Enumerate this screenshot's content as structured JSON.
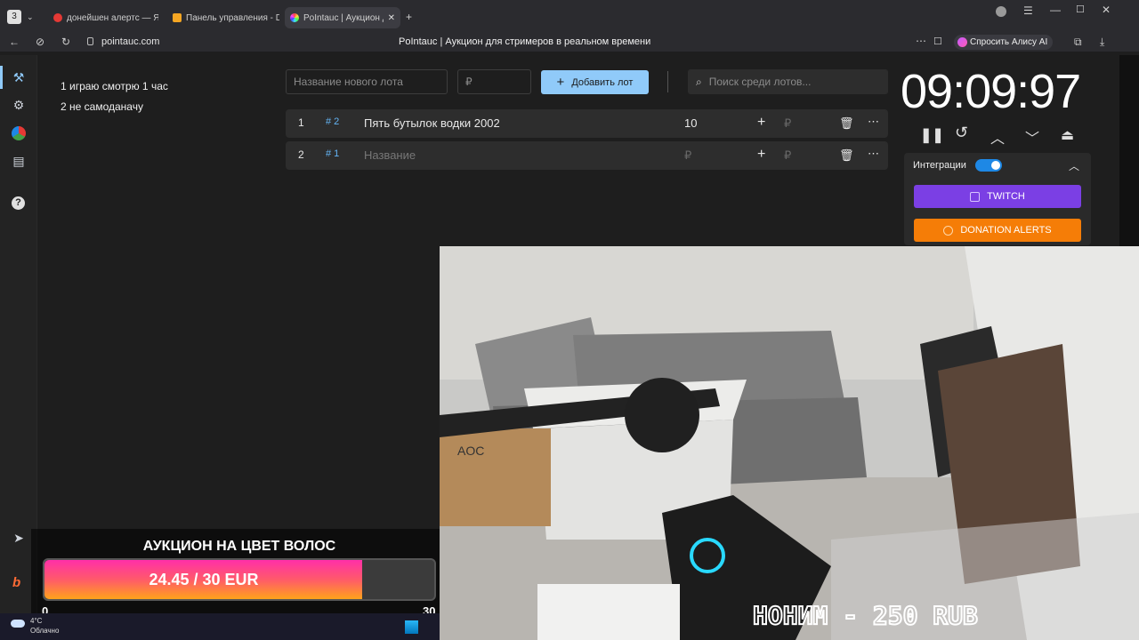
{
  "browser": {
    "tab_counter": "3",
    "tabs": [
      {
        "label": "донейшен алертс — Янде"
      },
      {
        "label": "Панель управления - Do"
      },
      {
        "label": "PoIntauc | Аукцион для"
      }
    ],
    "url": "pointauc.com",
    "page_title": "PoIntauc | Аукцион для стримеров в реальном времени",
    "alice_label": "Спросить Алису AI"
  },
  "notes": [
    "1 играю смотрю 1 час",
    "2 не самоданачу"
  ],
  "controls": {
    "new_lot_placeholder": "Название нового лота",
    "currency_placeholder": "₽",
    "add_label": "Добавить лот",
    "search_placeholder": "Поиск среди лотов..."
  },
  "lots": [
    {
      "index": "1",
      "id": "# 2",
      "name": "Пять бутылок водки 2002",
      "amount": "10"
    },
    {
      "index": "2",
      "id": "# 1",
      "name": "Название",
      "amount": "₽"
    }
  ],
  "currency_symbol": "₽",
  "timer": "09:09:97",
  "integrations": {
    "label": "Интеграции",
    "enabled": true,
    "twitch": "TWITCH",
    "donation_alerts": "DONATION ALERTS",
    "twitch_color": "#7b3fe4",
    "da_color": "#f57d07"
  },
  "overlay": {
    "title": "АУКЦИОН НА ЦВЕТ ВОЛОС",
    "progress_text": "24.45 / 30 EUR",
    "progress_fraction": 0.815,
    "min": "0",
    "max": "30"
  },
  "camera": {
    "caption": "НОНИМ - 250 RUB",
    "box_text": "AOC"
  },
  "weather": {
    "temp": "4°C",
    "desc": "Облачно"
  }
}
